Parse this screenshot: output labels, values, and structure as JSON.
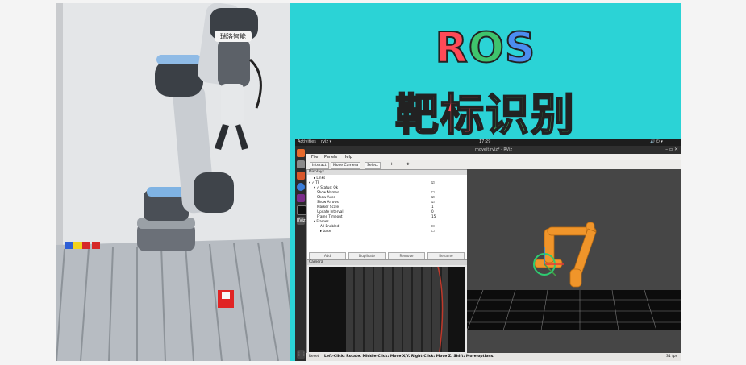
{
  "title": {
    "ros": [
      "R",
      "O",
      "S"
    ],
    "ros_colors": [
      "#ff4a57",
      "#3ec46d",
      "#4c8df0"
    ],
    "cn": [
      "靶",
      "标",
      "识",
      "别"
    ],
    "cn_colors": [
      "#ff4a57",
      "#ff4a57",
      "#3ec46d",
      "#3ec46d"
    ]
  },
  "photo": {
    "gripper_label": "瑞洛智能"
  },
  "desktop": {
    "activities": "Activities",
    "app_menu": "rviz ▾",
    "clock": "17:29",
    "window_title": "moveit.rviz* - RViz",
    "menu": [
      "File",
      "Panels",
      "Help"
    ],
    "toolbar": [
      "Interact",
      "Move Camera",
      "Select",
      "✛",
      "—",
      "✚"
    ],
    "displays_title": "Displays",
    "display_rows": [
      {
        "name": "▸ Links",
        "value": "",
        "indent": 8
      },
      {
        "name": "▾ ✓ TF",
        "value": "☑",
        "indent": 2
      },
      {
        "name": "▾ ✓ Status: Ok",
        "value": "",
        "indent": 8
      },
      {
        "name": "Show Names",
        "value": "☐",
        "indent": 12
      },
      {
        "name": "Show Axes",
        "value": "☑",
        "indent": 12
      },
      {
        "name": "Show Arrows",
        "value": "☑",
        "indent": 12
      },
      {
        "name": "Marker Scale",
        "value": "1",
        "indent": 12
      },
      {
        "name": "Update Interval",
        "value": "0",
        "indent": 12
      },
      {
        "name": "Frame Timeout",
        "value": "15",
        "indent": 12
      },
      {
        "name": "▾ Frames",
        "value": "",
        "indent": 8
      },
      {
        "name": "All Enabled",
        "value": "☐",
        "indent": 16
      },
      {
        "name": "▸ base",
        "value": "☐",
        "indent": 16
      }
    ],
    "display_buttons": [
      "Add",
      "Duplicate",
      "Remove",
      "Rename"
    ],
    "camera_title": "Camera",
    "status_bar": {
      "reset": "Reset",
      "hint": "Left-Click: Rotate. Middle-Click: Move X/Y. Right-Click: Move Z. Shift: More options.",
      "fps": "31 fps"
    }
  },
  "colors": {
    "background": "#2bd3d6",
    "robot_orange": "#f0952a"
  }
}
